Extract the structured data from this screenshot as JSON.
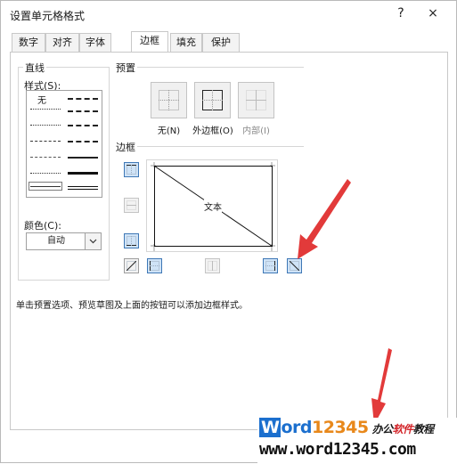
{
  "window": {
    "title": "设置单元格格式",
    "help_icon": "?",
    "close_icon": "×"
  },
  "tabs": [
    {
      "label": "数字"
    },
    {
      "label": "对齐"
    },
    {
      "label": "字体"
    },
    {
      "label": "边框",
      "active": true
    },
    {
      "label": "填充"
    },
    {
      "label": "保护"
    }
  ],
  "line": {
    "group_label": "直线",
    "style_label": "样式(S):",
    "style_none": "无",
    "color_label": "颜色(C):",
    "color_value": "自动",
    "color_dropdown_icon": "chevron-down-icon"
  },
  "presets": {
    "group_label": "预置",
    "items": [
      {
        "label": "无(N)"
      },
      {
        "label": "外边框(O)"
      },
      {
        "label": "内部(I)",
        "disabled": true
      }
    ]
  },
  "border": {
    "group_label": "边框",
    "preview_text": "文本"
  },
  "description": "单击预置选项、预览草图及上面的按钮可以添加边框样式。",
  "watermark": {
    "w": "W",
    "ord": "ord",
    "num": "12345",
    "cn_a": "办公",
    "cn_b": "软件",
    "cn_c": "教程",
    "url": "www.word12345.com"
  },
  "colors": {
    "accent": "#3f78b6",
    "arrow": "#e23a3a"
  }
}
